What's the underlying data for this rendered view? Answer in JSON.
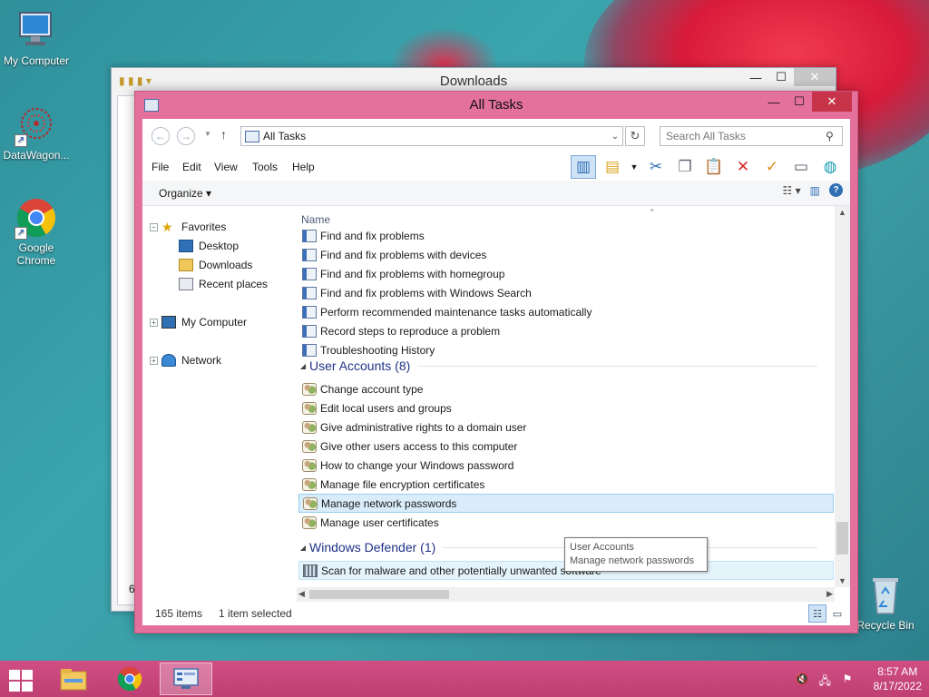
{
  "desktop": {
    "icons": [
      {
        "label": "My Computer"
      },
      {
        "label": "DataWagon..."
      },
      {
        "label": "Google Chrome"
      },
      {
        "label": "Recycle Bin"
      }
    ]
  },
  "back_window": {
    "title": "Downloads",
    "left_char": "6"
  },
  "window": {
    "title": "All Tasks",
    "controls": {
      "minimize": "—",
      "maximize": "☐",
      "close": "✕"
    }
  },
  "address": {
    "path": "All Tasks",
    "search_placeholder": "Search All Tasks"
  },
  "menu": {
    "items": [
      "File",
      "Edit",
      "View",
      "Tools",
      "Help"
    ]
  },
  "organize": {
    "label": "Organize"
  },
  "nav": {
    "favorites": "Favorites",
    "desktop": "Desktop",
    "downloads": "Downloads",
    "recent": "Recent places",
    "computer": "My Computer",
    "network": "Network"
  },
  "list": {
    "column_name": "Name",
    "troubleshooting_items": [
      "Find and fix problems",
      "Find and fix problems with devices",
      "Find and fix problems with homegroup",
      "Find and fix problems with Windows Search",
      "Perform recommended maintenance tasks automatically",
      "Record steps to reproduce a problem",
      "Troubleshooting History"
    ],
    "groups": [
      {
        "title": "User Accounts (8)",
        "items": [
          "Change account type",
          "Edit local users and groups",
          "Give administrative rights to a domain user",
          "Give other users access to this computer",
          "How to change your Windows password",
          "Manage file encryption certificates",
          "Manage network passwords",
          "Manage user certificates"
        ]
      },
      {
        "title": "Windows Defender (1)",
        "items": [
          "Scan for malware and other potentially unwanted software"
        ]
      }
    ]
  },
  "tooltip": {
    "line1": "User Accounts",
    "line2": "Manage network passwords"
  },
  "status": {
    "count": "165 items",
    "selected": "1 item selected"
  },
  "taskbar": {
    "time": "8:57 AM",
    "date": "8/17/2022"
  },
  "colors": {
    "window_frame": "#e4719b",
    "taskbar": "#c8457a",
    "group_title": "#1e3287",
    "selection": "#e5f3fb"
  }
}
